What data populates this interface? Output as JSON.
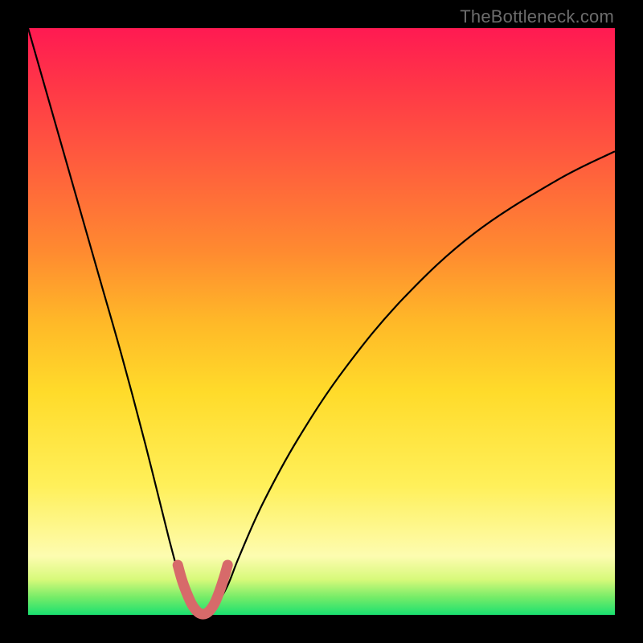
{
  "watermark": "TheBottleneck.com",
  "colors": {
    "curve_stroke": "#000000",
    "highlight_stroke": "#d76a6a",
    "frame_bg": "#000000"
  },
  "chart_data": {
    "type": "line",
    "title": "",
    "xlabel": "",
    "ylabel": "",
    "xlim": [
      0,
      100
    ],
    "ylim": [
      0,
      100
    ],
    "grid": false,
    "legend": false,
    "series": [
      {
        "name": "bottleneck-curve",
        "x": [
          0,
          4,
          8,
          12,
          16,
          20,
          24,
          26,
          28,
          29,
          30,
          31,
          32,
          34,
          36,
          40,
          46,
          54,
          64,
          76,
          90,
          100
        ],
        "y": [
          100,
          86,
          72,
          58,
          44,
          29,
          13,
          6,
          1.5,
          0.4,
          0,
          0.4,
          1.5,
          5,
          10,
          19,
          30,
          42,
          54,
          65,
          74,
          79
        ]
      },
      {
        "name": "bottom-highlight",
        "x": [
          25.5,
          26.2,
          27.0,
          27.8,
          28.6,
          29.4,
          30.2,
          31.0,
          31.8,
          32.6,
          33.4,
          34.0
        ],
        "y": [
          8.5,
          6.0,
          3.8,
          2.0,
          0.8,
          0.2,
          0.2,
          0.8,
          2.0,
          4.0,
          6.4,
          8.5
        ]
      }
    ],
    "annotations": []
  }
}
